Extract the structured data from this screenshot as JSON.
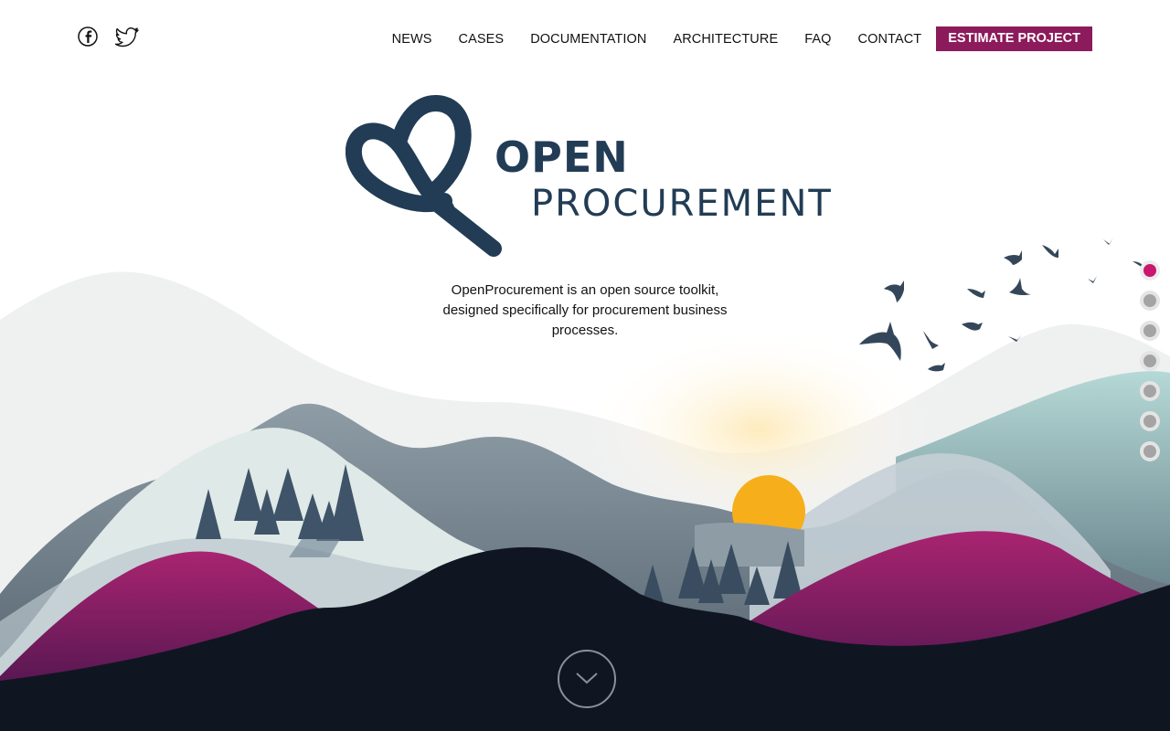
{
  "social": [
    {
      "name": "facebook-icon",
      "label": "f"
    },
    {
      "name": "twitter-icon",
      "label": "twitter"
    }
  ],
  "nav": {
    "items": [
      "NEWS",
      "CASES",
      "DOCUMENTATION",
      "ARCHITECTURE",
      "FAQ",
      "CONTACT"
    ],
    "cta": "ESTIMATE PROJECT"
  },
  "logo": {
    "word1": "OPEN",
    "word2": "PROCUREMENT"
  },
  "tagline": "OpenProcurement is an open source toolkit, designed specifically for procurement business processes.",
  "pagination": {
    "count": 7,
    "active_index": 0
  },
  "colors": {
    "accent": "#8c1b5c",
    "active_dot": "#c9166f",
    "logo": "#223c55",
    "sun": "#f6ae1a",
    "ground": "#0f1622",
    "magenta_hill": "#a72169"
  },
  "icons": {
    "scroll": "chevron-down-icon"
  }
}
